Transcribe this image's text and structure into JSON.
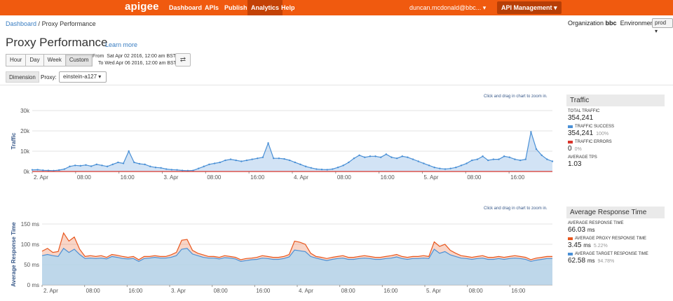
{
  "topbar": {
    "logo": "apigee",
    "nav": [
      "Dashboard",
      "APIs",
      "Publish",
      "Analytics",
      "Help"
    ],
    "active_nav": "Analytics",
    "user": "duncan.mcdonald@bbc... ▾",
    "api_management": "API Management ▾"
  },
  "breadcrumb": {
    "root": "Dashboard",
    "separator": "/",
    "current": "Proxy Performance"
  },
  "org": {
    "label": "Organization",
    "value": "bbc",
    "env_label": "Environment",
    "env_value": "prod ▾"
  },
  "page": {
    "title": "Proxy Performance",
    "learn_more": "Learn more"
  },
  "time_buttons": [
    "Hour",
    "Day",
    "Week",
    "Custom"
  ],
  "active_time": "Custom",
  "date_range": {
    "from_label": "From",
    "from": "Sat Apr 02 2016, 12:00 am BST",
    "to_label": "To",
    "to": "Wed Apr 06 2016, 12:00 am BST"
  },
  "swap_icon": "⇄",
  "dimension_label": "Dimension",
  "proxy": {
    "label": "Proxy:",
    "value": "einstein-a127 ▾"
  },
  "zoom_hint": "Click and drag in chart to zoom in.",
  "colors": {
    "brand": "#f05a0f",
    "blue": "#4a90d6",
    "orange": "#e8571e",
    "red": "#d9342b",
    "link": "#3a7ec2"
  },
  "traffic_panel": {
    "title": "Traffic",
    "total_label": "TOTAL TRAFFIC",
    "total": "354,241",
    "success_label": "TRAFFIC SUCCESS",
    "success": "354,241",
    "success_pct": "100%",
    "errors_label": "TRAFFIC ERRORS",
    "errors": "0",
    "errors_pct": "0%",
    "tps_label": "AVERAGE TPS",
    "tps": "1.03"
  },
  "response_panel": {
    "title": "Average Response Time",
    "avg_label": "AVERAGE RESPONSE TIME",
    "avg": "66.03",
    "unit": "ms",
    "proxy_label": "AVERAGE PROXY RESPONSE TIME",
    "proxy": "3.45",
    "proxy_pct": "5.22%",
    "target_label": "AVERAGE TARGET RESPONSE TIME",
    "target": "62.58",
    "target_pct": "94.78%"
  },
  "chart_data": [
    {
      "type": "area",
      "ylabel": "Traffic",
      "ylim": [
        0,
        30000
      ],
      "yticks": [
        "0k",
        "10k",
        "20k",
        "30k"
      ],
      "xticks": [
        "2. Apr",
        "08:00",
        "16:00",
        "3. Apr",
        "08:00",
        "16:00",
        "4. Apr",
        "08:00",
        "16:00",
        "5. Apr",
        "08:00",
        "16:00"
      ],
      "x_hours_range": [
        0,
        96
      ],
      "grid": true,
      "series": [
        {
          "name": "TRAFFIC SUCCESS",
          "values": [
            800,
            900,
            600,
            500,
            400,
            700,
            1200,
            2500,
            3000,
            2800,
            3200,
            2600,
            3500,
            3000,
            2500,
            3500,
            4500,
            4000,
            10000,
            4500,
            3800,
            3500,
            2500,
            2000,
            1800,
            1200,
            900,
            800,
            500,
            400,
            500,
            1500,
            2500,
            3500,
            4000,
            4500,
            5500,
            6000,
            5500,
            5000,
            5500,
            6000,
            6500,
            7000,
            14000,
            6500,
            6500,
            6200,
            5500,
            4500,
            3500,
            2500,
            1800,
            1200,
            1000,
            900,
            1200,
            2000,
            3000,
            4500,
            6500,
            8000,
            7000,
            7500,
            7500,
            7000,
            8500,
            7000,
            6500,
            7500,
            7000,
            6000,
            5000,
            4000,
            3000,
            2000,
            1500,
            1200,
            1500,
            2000,
            3000,
            4000,
            5500,
            6000,
            7500,
            5500,
            6000,
            6000,
            7500,
            7000,
            6000,
            5500,
            6000,
            19500,
            11000,
            8000,
            6000,
            5000
          ]
        },
        {
          "name": "TRAFFIC ERRORS",
          "values": [
            0
          ]
        }
      ]
    },
    {
      "type": "area",
      "ylabel": "Average Response Time",
      "ylim": [
        0,
        150
      ],
      "yticks": [
        "0 ms",
        "50 ms",
        "100 ms",
        "150 ms"
      ],
      "xticks": [
        "2. Apr",
        "08:00",
        "16:00",
        "3. Apr",
        "08:00",
        "16:00",
        "4. Apr",
        "08:00",
        "16:00",
        "5. Apr",
        "08:00",
        "16:00"
      ],
      "x_hours_range": [
        0,
        96
      ],
      "grid": true,
      "series": [
        {
          "name": "AVERAGE PROXY RESPONSE TIME",
          "values": [
            83,
            90,
            80,
            82,
            128,
            108,
            118,
            88,
            70,
            72,
            70,
            72,
            68,
            75,
            73,
            70,
            68,
            70,
            62,
            70,
            70,
            72,
            70,
            70,
            74,
            80,
            110,
            112,
            85,
            78,
            74,
            70,
            70,
            68,
            72,
            70,
            68,
            62,
            65,
            66,
            68,
            72,
            70,
            68,
            68,
            70,
            75,
            108,
            105,
            100,
            78,
            70,
            68,
            65,
            68,
            70,
            72,
            68,
            68,
            70,
            72,
            70,
            68,
            68,
            70,
            72,
            75,
            70,
            68,
            70,
            70,
            72,
            70,
            106,
            95,
            100,
            85,
            78,
            72,
            70,
            68,
            70,
            72,
            68,
            68,
            70,
            68,
            70,
            72,
            70,
            68,
            62,
            66,
            68,
            70,
            70
          ]
        },
        {
          "name": "AVERAGE TARGET RESPONSE TIME",
          "values": [
            72,
            75,
            72,
            70,
            90,
            80,
            88,
            75,
            65,
            66,
            65,
            66,
            64,
            70,
            68,
            65,
            64,
            65,
            58,
            65,
            66,
            68,
            66,
            66,
            68,
            72,
            88,
            90,
            76,
            72,
            68,
            66,
            66,
            64,
            67,
            66,
            64,
            58,
            60,
            62,
            63,
            66,
            65,
            63,
            63,
            65,
            69,
            86,
            84,
            82,
            70,
            66,
            63,
            60,
            63,
            65,
            66,
            63,
            63,
            65,
            66,
            65,
            63,
            63,
            65,
            66,
            69,
            65,
            63,
            65,
            65,
            66,
            65,
            88,
            78,
            82,
            74,
            70,
            66,
            65,
            63,
            65,
            66,
            63,
            63,
            65,
            63,
            65,
            66,
            65,
            63,
            58,
            61,
            63,
            65,
            65
          ]
        }
      ]
    }
  ]
}
